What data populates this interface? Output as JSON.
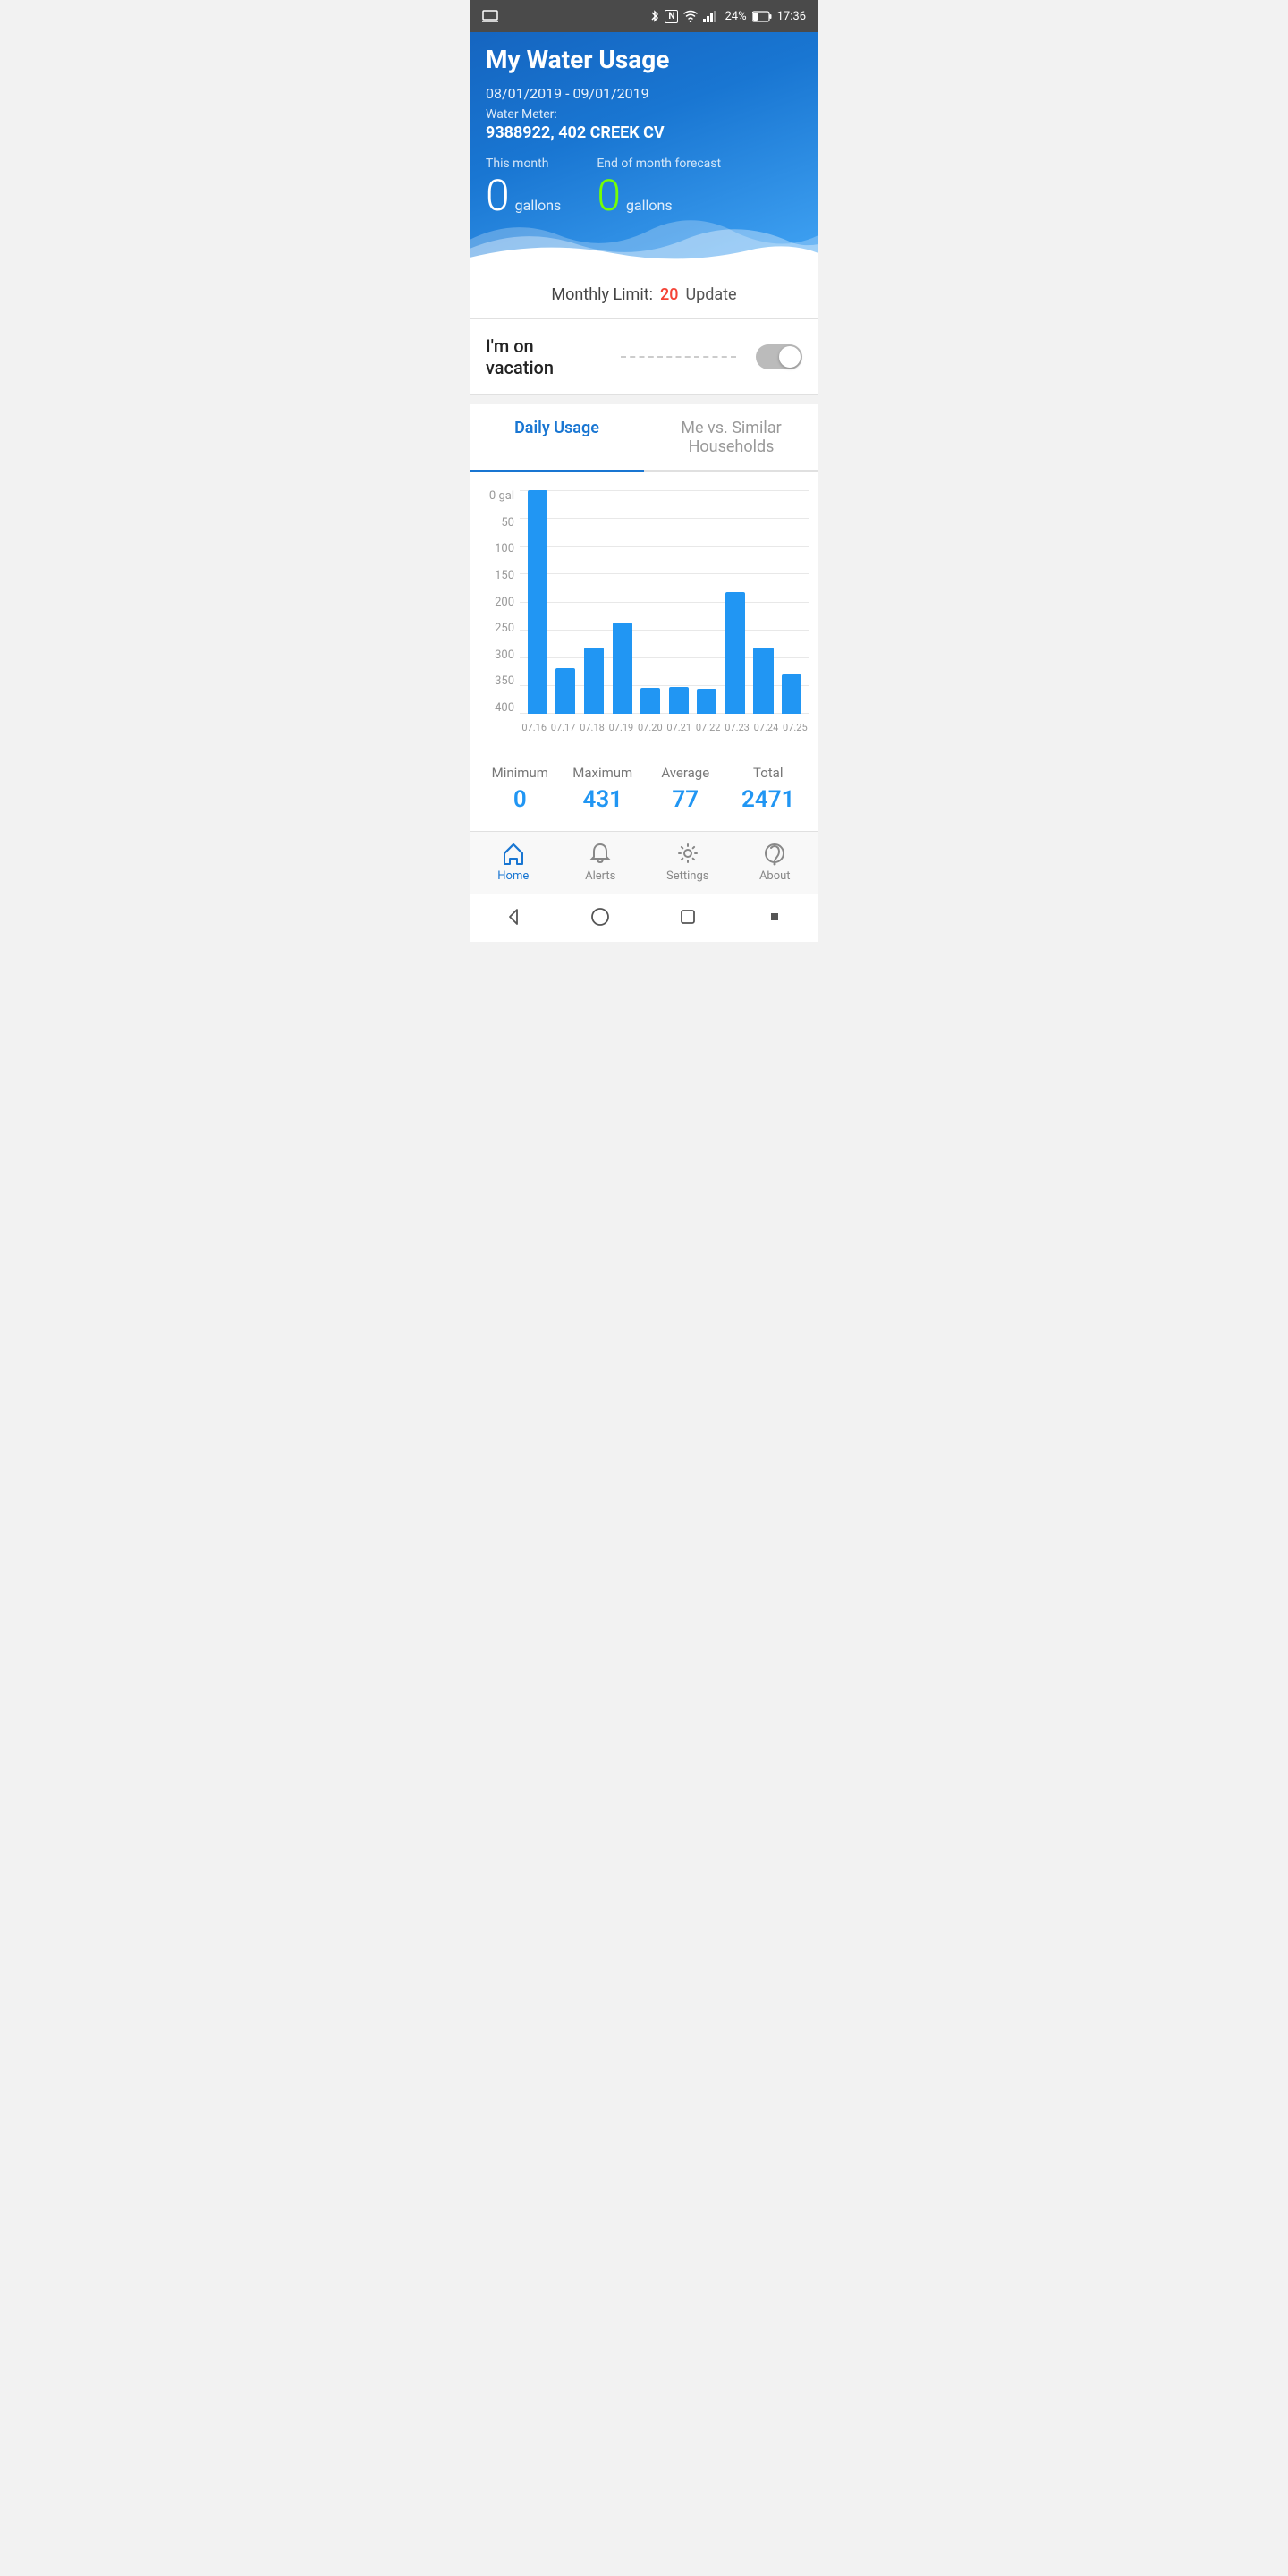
{
  "statusBar": {
    "battery": "24%",
    "time": "17:36"
  },
  "header": {
    "title": "My Water Usage",
    "dateRange": "08/01/2019 - 09/01/2019",
    "meterLabel": "Water Meter:",
    "meterId": "9388922, 402 CREEK CV"
  },
  "usage": {
    "thisMonthLabel": "This month",
    "thisMonthValue": "0",
    "forecastLabel": "End of month forecast",
    "forecastValue": "0",
    "unit": "gallons"
  },
  "monthlyLimit": {
    "label": "Monthly Limit:",
    "value": "20",
    "updateLabel": "Update"
  },
  "vacation": {
    "label": "I'm on vacation"
  },
  "tabs": {
    "active": "Daily Usage",
    "inactive": "Me vs. Similar Households"
  },
  "chart": {
    "yLabels": [
      "0 gal",
      "50",
      "100",
      "150",
      "200",
      "250",
      "300",
      "350",
      "400"
    ],
    "maxValue": 431,
    "bars": [
      {
        "date": "07.16",
        "value": 431
      },
      {
        "date": "07.17",
        "value": 88
      },
      {
        "date": "07.18",
        "value": 128
      },
      {
        "date": "07.19",
        "value": 175
      },
      {
        "date": "07.20",
        "value": 50
      },
      {
        "date": "07.21",
        "value": 52
      },
      {
        "date": "07.22",
        "value": 48
      },
      {
        "date": "07.23",
        "value": 235
      },
      {
        "date": "07.24",
        "value": 128
      },
      {
        "date": "07.25",
        "value": 76
      }
    ]
  },
  "stats": {
    "minimum": {
      "label": "Minimum",
      "value": "0"
    },
    "maximum": {
      "label": "Maximum",
      "value": "431"
    },
    "average": {
      "label": "Average",
      "value": "77"
    },
    "total": {
      "label": "Total",
      "value": "2471"
    }
  },
  "bottomNav": [
    {
      "id": "home",
      "label": "Home",
      "active": true
    },
    {
      "id": "alerts",
      "label": "Alerts",
      "active": false
    },
    {
      "id": "settings",
      "label": "Settings",
      "active": false
    },
    {
      "id": "about",
      "label": "About",
      "active": false
    }
  ]
}
